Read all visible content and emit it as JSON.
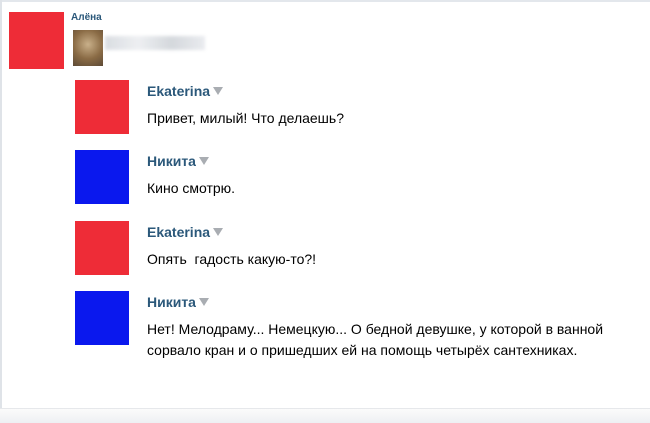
{
  "header": {
    "name": "Алёна"
  },
  "colors": {
    "red": "#ee2c37",
    "blue": "#0a18ee",
    "name": "#2b587a"
  },
  "messages": [
    {
      "author": "Ekaterina",
      "text": "Привет, милый! Что делаешь?",
      "avatar_color": "#ee2c37"
    },
    {
      "author": "Никита",
      "text": "Кино смотрю.",
      "avatar_color": "#0a18ee"
    },
    {
      "author": "Ekaterina",
      "text": "Опять  гадость какую-то?!",
      "avatar_color": "#ee2c37"
    },
    {
      "author": "Никита",
      "text": "Нет! Мелодраму... Немецкую... О бедной девушке, у которой в ванной сорвало кран и о пришедших ей на помощь четырёх сантехниках.",
      "avatar_color": "#0a18ee"
    }
  ]
}
